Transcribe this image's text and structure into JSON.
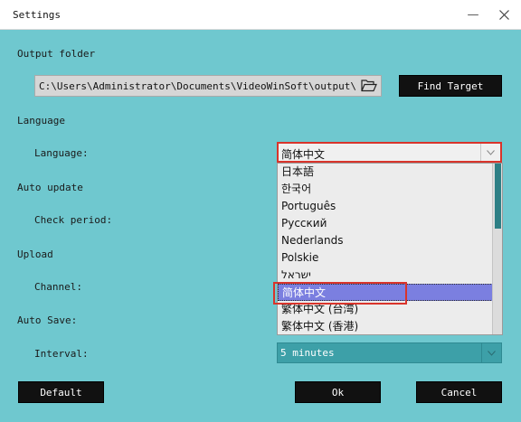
{
  "window": {
    "title": "Settings",
    "minimize_glyph": "—"
  },
  "output": {
    "section_label": "Output folder",
    "path_value": "C:\\Users\\Administrator\\Documents\\VideoWinSoft\\output\\",
    "folder_icon": "folder-open-icon",
    "find_target_label": "Find Target"
  },
  "language": {
    "section_label": "Language",
    "field_label": "Language:",
    "selected": "简体中文",
    "options": [
      {
        "label": "日本語"
      },
      {
        "label": "한국어"
      },
      {
        "label": "Português"
      },
      {
        "label": "Русский"
      },
      {
        "label": "Nederlands"
      },
      {
        "label": "Polskie"
      },
      {
        "label": "ישראל"
      },
      {
        "label": "简体中文"
      },
      {
        "label": "繁体中文 (台湾)"
      },
      {
        "label": "繁体中文 (香港)"
      }
    ]
  },
  "auto_update": {
    "section_label": "Auto update",
    "field_label": "Check period:"
  },
  "upload": {
    "section_label": "Upload",
    "field_label": "Channel:"
  },
  "auto_save": {
    "section_label": "Auto Save:",
    "field_label": "Interval:",
    "interval_value": "5 minutes"
  },
  "footer": {
    "default_label": "Default",
    "ok_label": "Ok",
    "cancel_label": "Cancel"
  },
  "colors": {
    "background": "#6fc8cf",
    "combo": "#3da0a8",
    "button": "#111111",
    "selection": "#7b7fe0",
    "highlight": "#d9342b"
  }
}
